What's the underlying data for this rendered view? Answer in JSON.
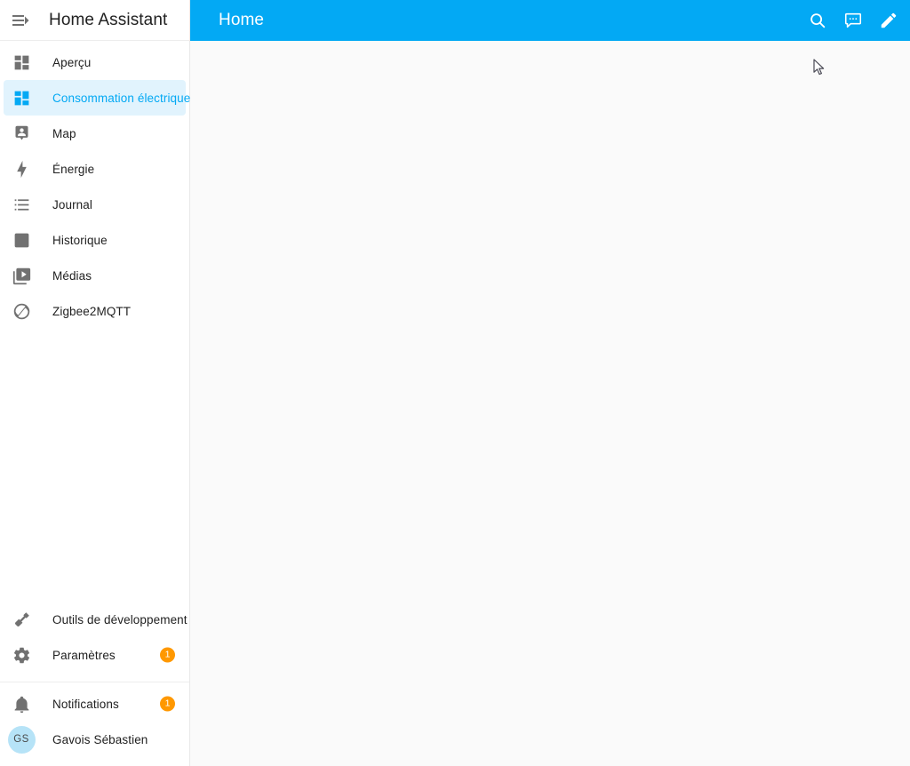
{
  "sidebar": {
    "menu_toggle_icon": "menu-open-icon",
    "title": "Home Assistant",
    "items": [
      {
        "label": "Aperçu",
        "icon": "view-dashboard-icon",
        "active": false,
        "badge": ""
      },
      {
        "label": "Consommation électrique",
        "icon": "view-dashboard-icon",
        "active": true,
        "badge": ""
      },
      {
        "label": "Map",
        "icon": "account-box-icon",
        "active": false,
        "badge": ""
      },
      {
        "label": "Énergie",
        "icon": "lightning-bolt-icon",
        "active": false,
        "badge": ""
      },
      {
        "label": "Journal",
        "icon": "format-list-bulleted-icon",
        "active": false,
        "badge": ""
      },
      {
        "label": "Historique",
        "icon": "chart-box-icon",
        "active": false,
        "badge": ""
      },
      {
        "label": "Médias",
        "icon": "play-box-multiple-icon",
        "active": false,
        "badge": ""
      },
      {
        "label": "Zigbee2MQTT",
        "icon": "zigbee-icon",
        "active": false,
        "badge": ""
      }
    ],
    "bottom_items": [
      {
        "label": "Outils de développement",
        "icon": "hammer-icon",
        "badge": ""
      },
      {
        "label": "Paramètres",
        "icon": "cog-icon",
        "badge": "1"
      }
    ],
    "footer_items": [
      {
        "label": "Notifications",
        "icon": "bell-icon",
        "badge": "1"
      },
      {
        "label": "Gavois Sébastien",
        "icon": "avatar",
        "badge": "",
        "initials": "GS"
      }
    ]
  },
  "toolbar": {
    "title": "Home",
    "search_icon": "search-icon",
    "assist_icon": "assist-conversation-icon",
    "edit_icon": "pencil-icon"
  },
  "colors": {
    "accent": "#03a9f4",
    "active_bg": "#e1f3fd",
    "badge": "#ff9800",
    "avatar_bg": "#b6e3f7",
    "content_bg": "#fafafa",
    "text": "#212121",
    "icon": "#717171"
  }
}
